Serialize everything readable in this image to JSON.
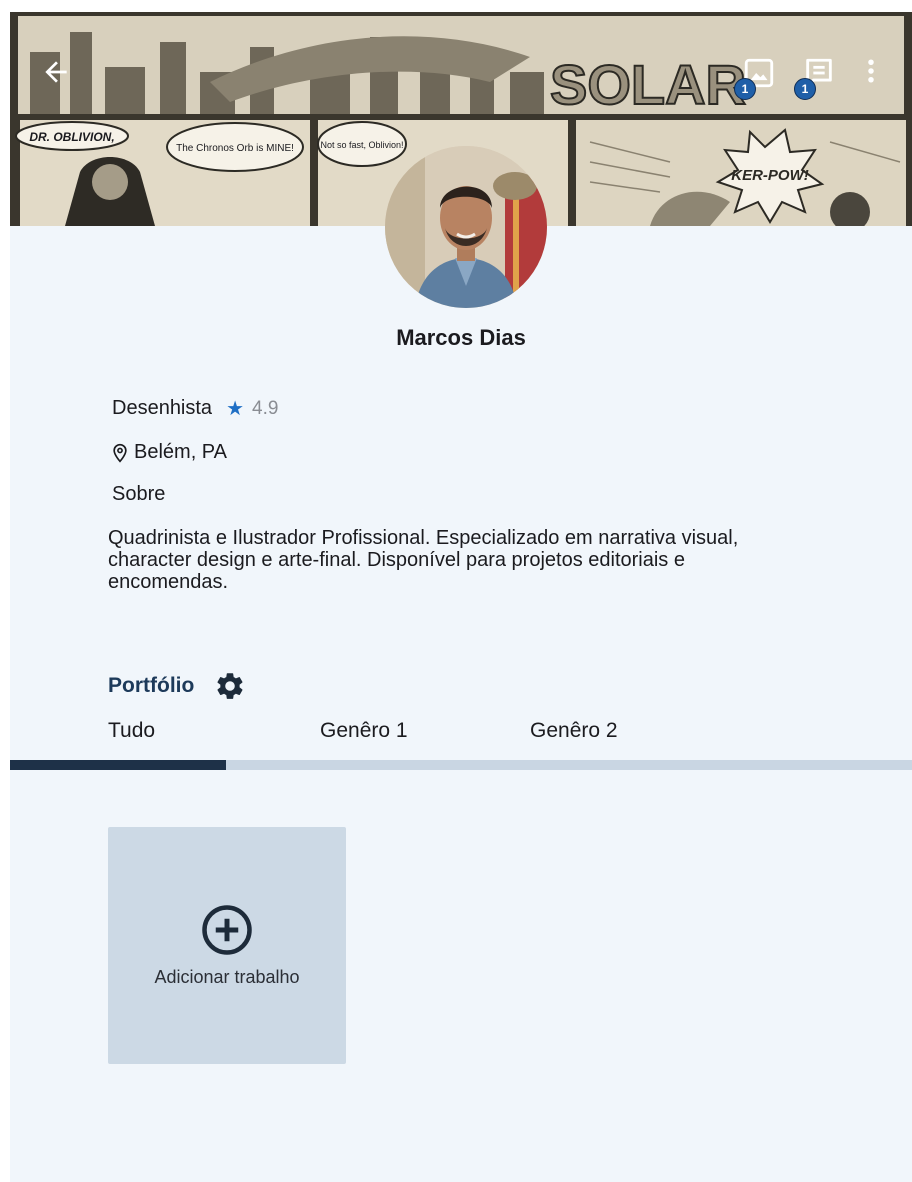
{
  "banner": {
    "comic_title": "SOLAR",
    "captions": [
      "DR. OBLIVION,",
      "The Chronos Orb is MINE!",
      "Not so fast, Oblivion!",
      "KER-POW!"
    ],
    "gallery_badge": "1",
    "messages_badge": "1"
  },
  "profile": {
    "name": "Marcos Dias",
    "profession": "Desenhista",
    "rating": "4.9",
    "location": "Belém, PA",
    "about_title": "Sobre",
    "about_text": "Quadrinista e Ilustrador Profissional. Especializado em narrativa visual, character design e arte-final. Disponível para projetos editoriais e encomendas."
  },
  "portfolio": {
    "title": "Portfólio",
    "tabs": [
      "Tudo",
      "Genêro 1",
      "Genêro 2"
    ],
    "selected_tab": 0,
    "add_label": "Adicionar trabalho"
  },
  "colors": {
    "background": "#f1f6fb",
    "accent": "#1e3148",
    "star": "#1f6fc5",
    "card": "#ccd9e5"
  }
}
